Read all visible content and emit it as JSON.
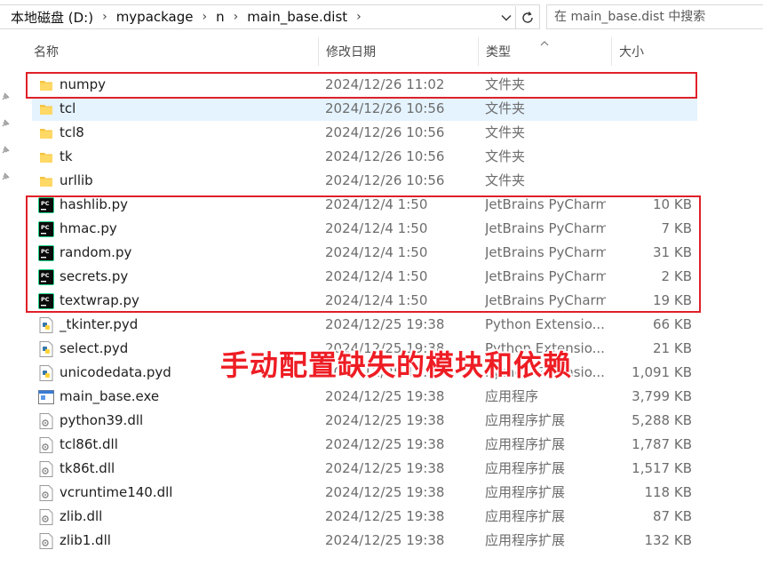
{
  "breadcrumb": {
    "items": [
      "本地磁盘 (D:)",
      "mypackage",
      "n",
      "main_base.dist"
    ]
  },
  "search": {
    "placeholder": "在 main_base.dist 中搜索"
  },
  "columns": {
    "name": "名称",
    "date": "修改日期",
    "type": "类型",
    "size": "大小"
  },
  "files": [
    {
      "name": "numpy",
      "date": "2024/12/26 11:02",
      "type": "文件夹",
      "size": "",
      "icon": "folder-icon"
    },
    {
      "name": "tcl",
      "date": "2024/12/26 10:56",
      "type": "文件夹",
      "size": "",
      "icon": "folder-icon"
    },
    {
      "name": "tcl8",
      "date": "2024/12/26 10:56",
      "type": "文件夹",
      "size": "",
      "icon": "folder-icon"
    },
    {
      "name": "tk",
      "date": "2024/12/26 10:56",
      "type": "文件夹",
      "size": "",
      "icon": "folder-icon"
    },
    {
      "name": "urllib",
      "date": "2024/12/26 10:56",
      "type": "文件夹",
      "size": "",
      "icon": "folder-icon"
    },
    {
      "name": "hashlib.py",
      "date": "2024/12/4 1:50",
      "type": "JetBrains PyCharm",
      "size": "10 KB",
      "icon": "pycharm-icon"
    },
    {
      "name": "hmac.py",
      "date": "2024/12/4 1:50",
      "type": "JetBrains PyCharm",
      "size": "7 KB",
      "icon": "pycharm-icon"
    },
    {
      "name": "random.py",
      "date": "2024/12/4 1:50",
      "type": "JetBrains PyCharm",
      "size": "31 KB",
      "icon": "pycharm-icon"
    },
    {
      "name": "secrets.py",
      "date": "2024/12/4 1:50",
      "type": "JetBrains PyCharm",
      "size": "2 KB",
      "icon": "pycharm-icon"
    },
    {
      "name": "textwrap.py",
      "date": "2024/12/4 1:50",
      "type": "JetBrains PyCharm",
      "size": "19 KB",
      "icon": "pycharm-icon"
    },
    {
      "name": "_tkinter.pyd",
      "date": "2024/12/25 19:38",
      "type": "Python Extensio...",
      "size": "66 KB",
      "icon": "python-file-icon"
    },
    {
      "name": "select.pyd",
      "date": "2024/12/25 19:38",
      "type": "Python Extensio...",
      "size": "21 KB",
      "icon": "python-file-icon"
    },
    {
      "name": "unicodedata.pyd",
      "date": "2024/12/25 19:38",
      "type": "Python Extensio...",
      "size": "1,091 KB",
      "icon": "python-file-icon"
    },
    {
      "name": "main_base.exe",
      "date": "2024/12/25 19:38",
      "type": "应用程序",
      "size": "3,799 KB",
      "icon": "exe-icon"
    },
    {
      "name": "python39.dll",
      "date": "2024/12/25 19:38",
      "type": "应用程序扩展",
      "size": "5,288 KB",
      "icon": "dll-icon"
    },
    {
      "name": "tcl86t.dll",
      "date": "2024/12/25 19:38",
      "type": "应用程序扩展",
      "size": "1,787 KB",
      "icon": "dll-icon"
    },
    {
      "name": "tk86t.dll",
      "date": "2024/12/25 19:38",
      "type": "应用程序扩展",
      "size": "1,517 KB",
      "icon": "dll-icon"
    },
    {
      "name": "vcruntime140.dll",
      "date": "2024/12/25 19:38",
      "type": "应用程序扩展",
      "size": "118 KB",
      "icon": "dll-icon"
    },
    {
      "name": "zlib.dll",
      "date": "2024/12/25 19:38",
      "type": "应用程序扩展",
      "size": "87 KB",
      "icon": "dll-icon"
    },
    {
      "name": "zlib1.dll",
      "date": "2024/12/25 19:38",
      "type": "应用程序扩展",
      "size": "132 KB",
      "icon": "dll-icon"
    }
  ],
  "annotation": {
    "text": "手动配置缺失的模块和依赖"
  },
  "colors": {
    "highlight": "#e0202a",
    "annotation": "#ee1d24",
    "selected_row": "#e5f3ff",
    "folder": "#f4c542"
  }
}
